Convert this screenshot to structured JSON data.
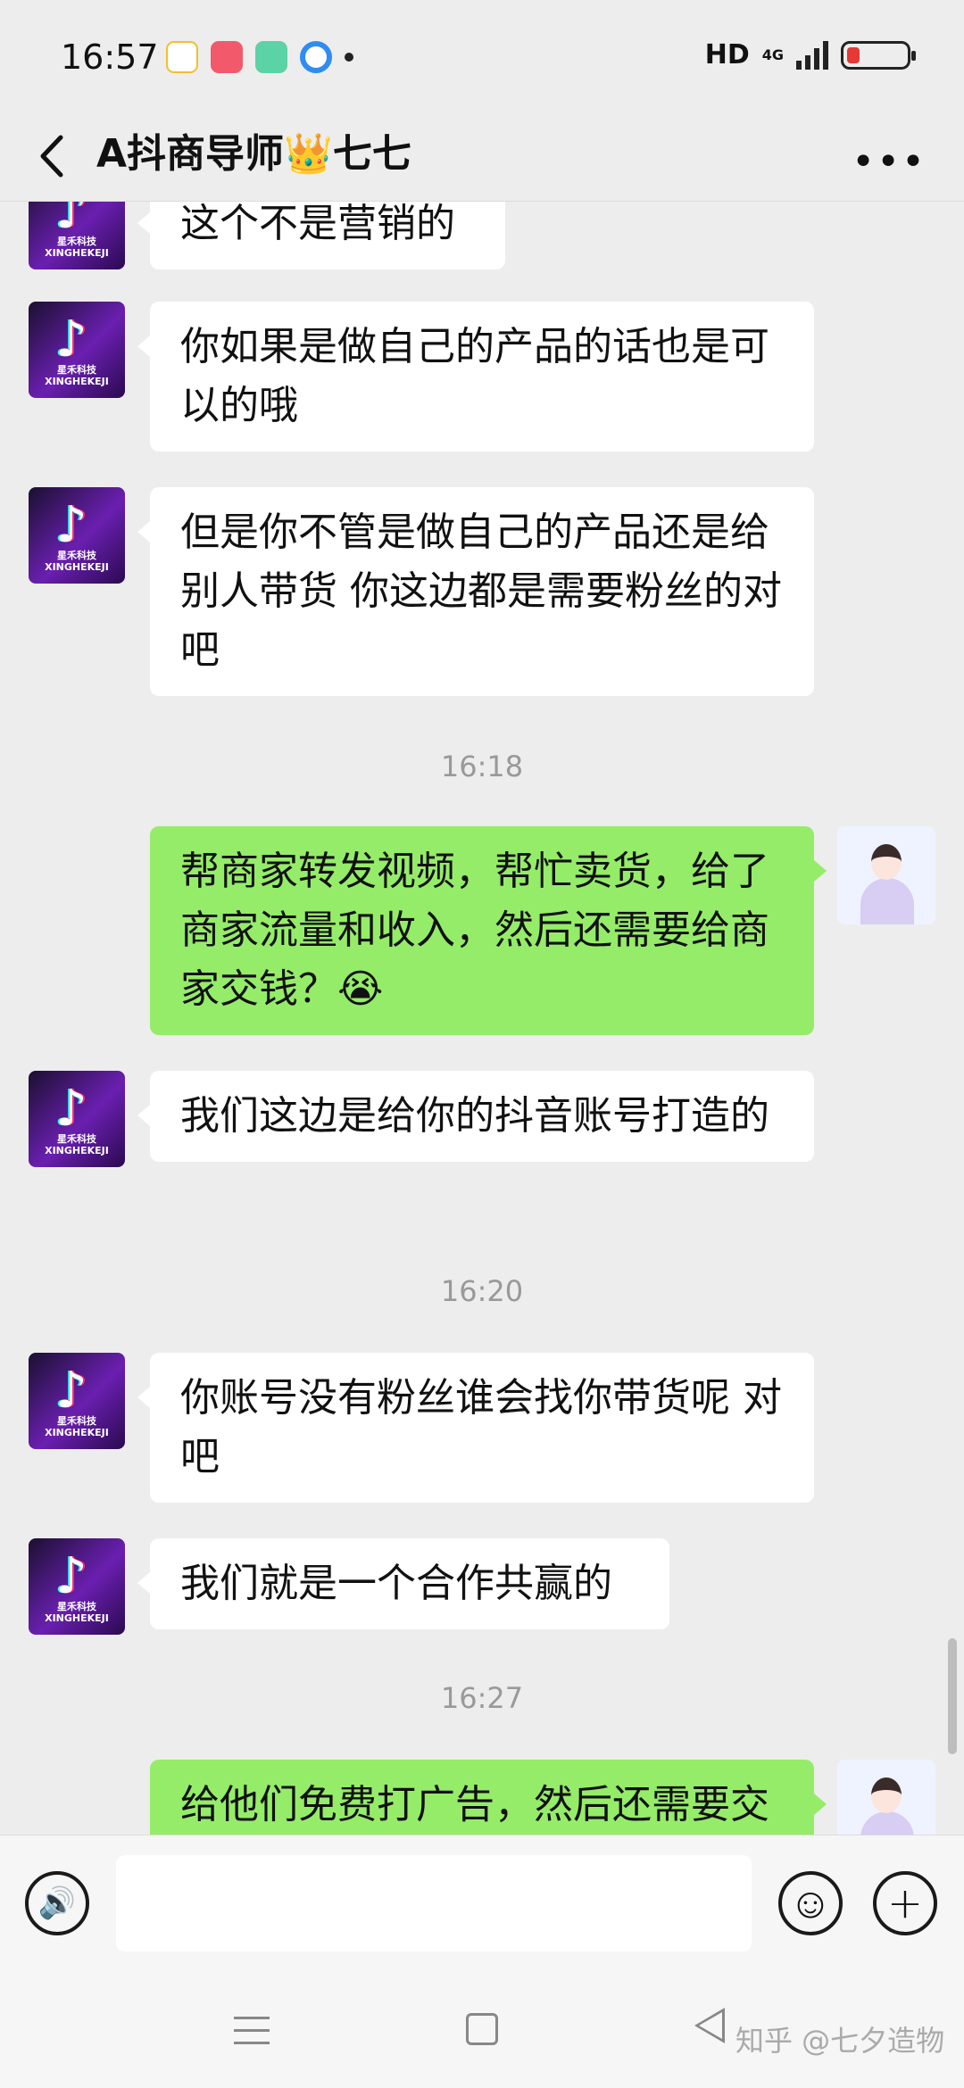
{
  "status": {
    "time": "16:57",
    "hd": "HD",
    "net": "4G"
  },
  "header": {
    "title": "A抖商导师👑七七",
    "more": "•••"
  },
  "avatar_brand": {
    "cn": "星禾科技",
    "en": "XINGHEKEJI"
  },
  "messages": [
    {
      "side": "left",
      "text": "这个不是营销的"
    },
    {
      "side": "left",
      "text": " 你如果是做自己的产品的话也是可以的哦"
    },
    {
      "side": "left",
      "text": " 但是你不管是做自己的产品还是给别人带货  你这边都是需要粉丝的对吧"
    },
    {
      "type": "time",
      "text": "16:18"
    },
    {
      "side": "right",
      "text": "帮商家转发视频，帮忙卖货，给了商家流量和收入，然后还需要给商家交钱？😭"
    },
    {
      "side": "left",
      "text": "  我们这边是给你的抖音账号打造的"
    },
    {
      "type": "time",
      "text": "16:20"
    },
    {
      "side": "left",
      "text": "你账号没有粉丝谁会找你带货呢 对吧"
    },
    {
      "side": "left",
      "text": "我们就是一个合作共赢的"
    },
    {
      "type": "time",
      "text": "16:27"
    },
    {
      "side": "right",
      "text": "给他们免费打广告，然后还需要交"
    }
  ],
  "input": {
    "voice": "🔊",
    "emoji": "☺",
    "plus": "+"
  },
  "watermark": "知乎 @七夕造物"
}
